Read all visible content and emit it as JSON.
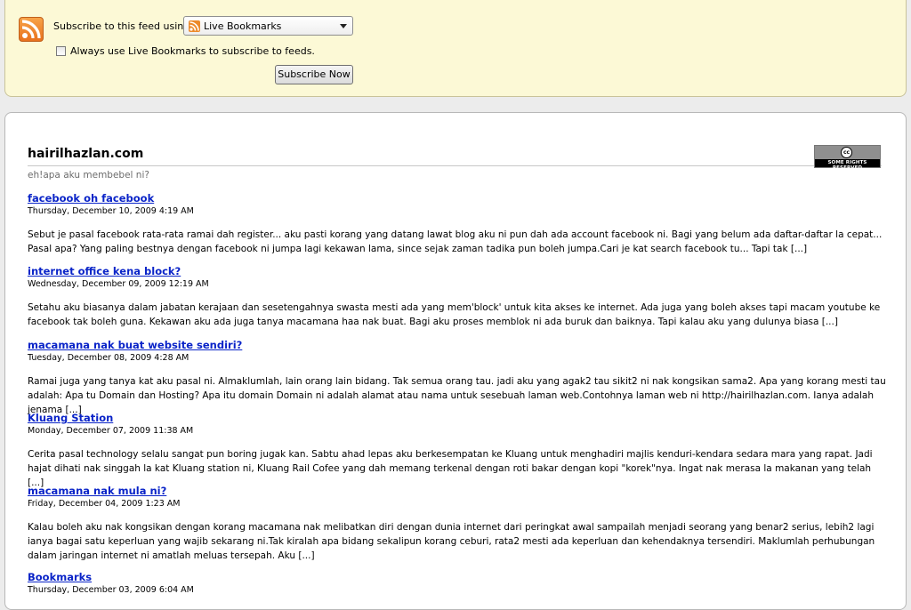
{
  "subscribe": {
    "label": "Subscribe to this feed using",
    "selected_reader": "Live Bookmarks",
    "checkbox_label": "Always use Live Bookmarks to subscribe to feeds.",
    "button_label": "Subscribe Now",
    "checkbox_checked": false
  },
  "feed": {
    "site_title": "hairilhazlan.com",
    "site_subtitle": "eh!apa aku membebel ni?",
    "license_badge": "SOME RIGHTS RESERVED",
    "entries": [
      {
        "title": "facebook oh facebook",
        "date": "Thursday, December 10, 2009 4:19 AM",
        "body": "Sebut je pasal facebook rata-rata ramai dah register... aku pasti korang yang datang lawat blog aku ni pun dah ada account facebook ni. Bagi yang belum ada daftar-daftar la cepat... Pasal apa? Yang paling bestnya dengan facebook ni jumpa lagi kekawan lama, since sejak zaman tadika pun boleh jumpa.Cari je kat search facebook tu... Tapi tak [...]"
      },
      {
        "title": "internet office kena block?",
        "date": "Wednesday, December 09, 2009 12:19 AM",
        "body": "Setahu aku biasanya dalam jabatan kerajaan dan sesetengahnya swasta mesti ada yang mem'block' untuk kita akses ke internet. Ada juga yang boleh akses tapi macam youtube ke facebook tak boleh guna. Kekawan aku ada juga tanya macamana haa nak buat. Bagi aku proses memblok ni ada buruk dan baiknya. Tapi kalau aku yang dulunya biasa [...]"
      },
      {
        "title": "macamana nak buat website sendiri?",
        "date": "Tuesday, December 08, 2009 4:28 AM",
        "body": "Ramai juga yang tanya kat aku pasal ni. Almaklumlah, lain orang lain bidang. Tak semua orang tau. jadi aku yang agak2 tau sikit2 ni nak kongsikan sama2. Apa yang korang mesti tau adalah: Apa tu Domain dan Hosting? Apa itu domain Domain ni adalah alamat atau nama untuk sesebuah laman web.Contohnya laman web ni http://hairilhazlan.com. Ianya adalah jenama [...]"
      },
      {
        "title": "Kluang Station",
        "date": "Monday, December 07, 2009 11:38 AM",
        "body": "Cerita pasal technology selalu sangat pun boring jugak kan. Sabtu ahad lepas aku berkesempatan ke Kluang untuk menghadiri majlis kenduri-kendara sedara mara yang rapat. Jadi hajat dihati nak singgah la kat Kluang station ni, Kluang Rail Cofee yang dah memang terkenal dengan roti bakar dengan kopi \"korek\"nya. Ingat nak merasa la makanan yang telah [...]"
      },
      {
        "title": "macamana nak mula ni?",
        "date": "Friday, December 04, 2009 1:23 AM",
        "body": "Kalau boleh aku nak kongsikan dengan korang macamana nak melibatkan diri dengan dunia internet dari peringkat awal sampailah menjadi seorang yang benar2 serius, lebih2 lagi ianya bagai satu keperluan yang wajib sekarang ni.Tak kiralah apa bidang sekalipun korang ceburi, rata2 mesti ada keperluan dan kehendaknya tersendiri. Maklumlah perhubungan dalam jaringan internet ni amatlah meluas tersepah. Aku [...]"
      },
      {
        "title": "Bookmarks",
        "date": "Thursday, December 03, 2009 6:04 AM",
        "body": ""
      }
    ]
  }
}
